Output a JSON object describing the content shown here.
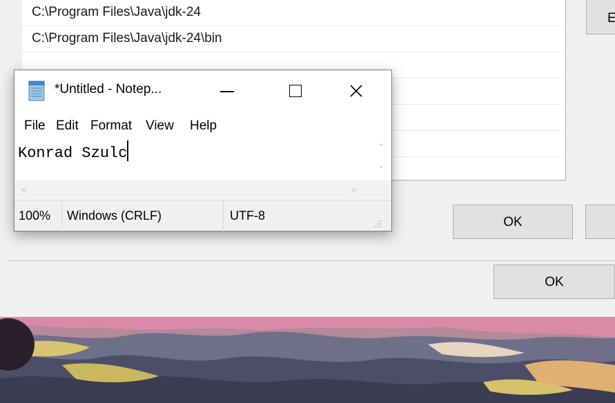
{
  "env_dialog": {
    "path_rows": [
      "C:\\Program Files\\Java\\jdk-24",
      "C:\\Program Files\\Java\\jdk-24\\bin",
      "",
      "",
      "",
      ""
    ],
    "side_button_label": "E",
    "ok_label": "OK"
  },
  "system_dialog": {
    "ok_label": "OK"
  },
  "notepad": {
    "title": "*Untitled - Notep...",
    "menu": [
      "File",
      "Edit",
      "Format",
      "View",
      "Help"
    ],
    "text": "Konrad Szulc",
    "status": {
      "zoom": "100%",
      "line_ending": "Windows (CRLF)",
      "encoding": "UTF-8"
    },
    "icons": {
      "app": "notepad-icon",
      "minimize": "minimize-icon",
      "maximize": "maximize-icon",
      "close": "close-icon"
    }
  },
  "colors": {
    "window_bg": "#f0f0f0",
    "button_bg": "#e1e1e1",
    "button_border": "#adadad"
  }
}
